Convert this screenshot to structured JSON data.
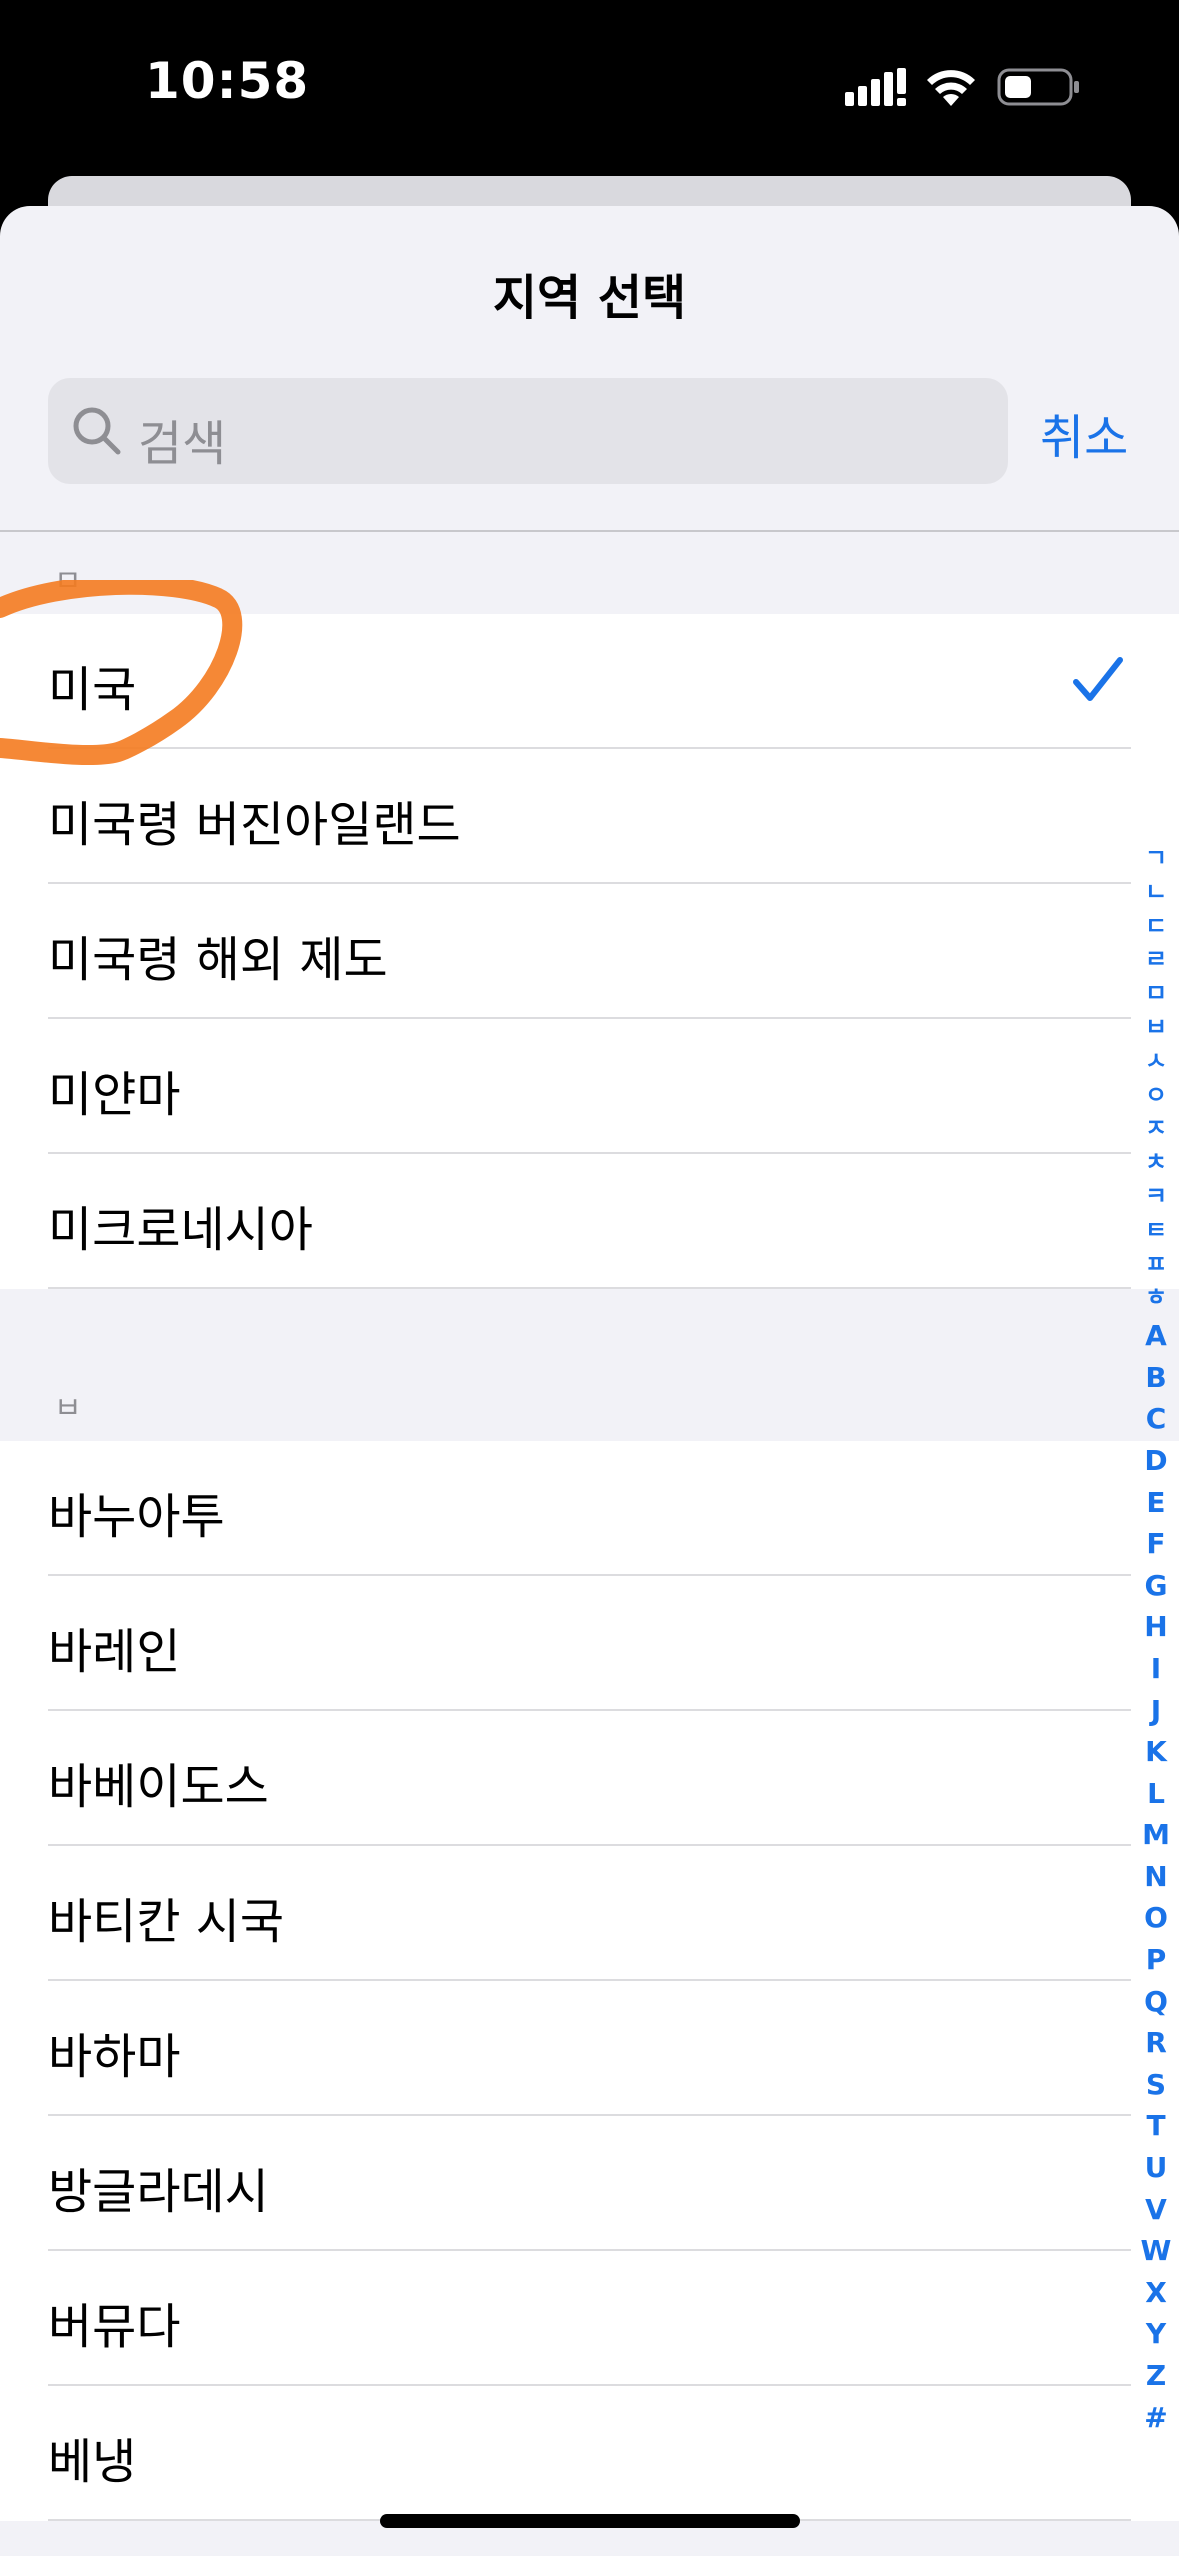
{
  "status_bar": {
    "time": "10:58"
  },
  "header": {
    "title": "지역 선택",
    "search_placeholder": "검색",
    "cancel_label": "취소"
  },
  "sections": [
    {
      "letter": "ㅁ",
      "items": [
        {
          "label": "미국",
          "selected": true
        },
        {
          "label": "미국령 버진아일랜드"
        },
        {
          "label": "미국령 해외 제도"
        },
        {
          "label": "미얀마"
        },
        {
          "label": "미크로네시아"
        }
      ]
    },
    {
      "letter": "ㅂ",
      "items": [
        {
          "label": "바누아투"
        },
        {
          "label": "바레인"
        },
        {
          "label": "바베이도스"
        },
        {
          "label": "바티칸 시국"
        },
        {
          "label": "바하마"
        },
        {
          "label": "방글라데시"
        },
        {
          "label": "버뮤다"
        },
        {
          "label": "베냉"
        }
      ]
    }
  ],
  "index_korean": [
    "ㄱ",
    "ㄴ",
    "ㄷ",
    "ㄹ",
    "ㅁ",
    "ㅂ",
    "ㅅ",
    "ㅇ",
    "ㅈ",
    "ㅊ",
    "ㅋ",
    "ㅌ",
    "ㅍ",
    "ㅎ"
  ],
  "index_latin": [
    "A",
    "B",
    "C",
    "D",
    "E",
    "F",
    "G",
    "H",
    "I",
    "J",
    "K",
    "L",
    "M",
    "N",
    "O",
    "P",
    "Q",
    "R",
    "S",
    "T",
    "U",
    "V",
    "W",
    "X",
    "Y",
    "Z",
    "#"
  ],
  "colors": {
    "accent": "#1a73e8",
    "annotation": "#f47b20"
  }
}
